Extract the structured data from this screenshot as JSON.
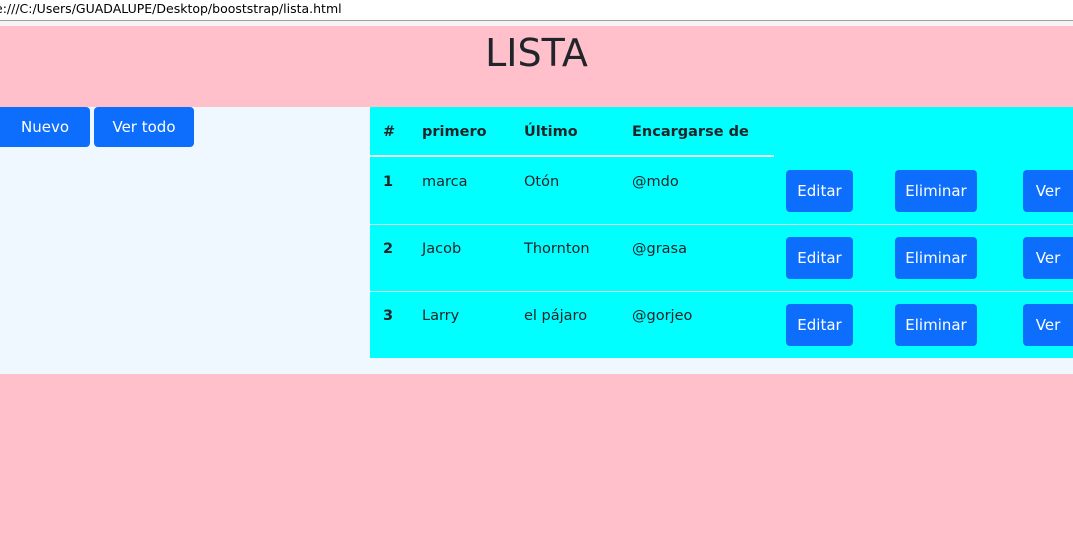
{
  "browser": {
    "url": "e:///C:/Users/GUADALUPE/Desktop/booststrap/lista.html"
  },
  "page": {
    "title": "LISTA"
  },
  "toolbar": {
    "new_label": "Nuevo",
    "view_all_label": "Ver todo"
  },
  "table": {
    "headers": [
      "#",
      "primero",
      "Último",
      "Encargarse de"
    ],
    "rows": [
      {
        "num": "1",
        "first": "marca",
        "last": "Otón",
        "handle": "@mdo",
        "edit": "Editar",
        "delete": "Eliminar",
        "view": "Ver"
      },
      {
        "num": "2",
        "first": "Jacob",
        "last": "Thornton",
        "handle": "@grasa",
        "edit": "Editar",
        "delete": "Eliminar",
        "view": "Ver"
      },
      {
        "num": "3",
        "first": "Larry",
        "last": "el pájaro",
        "handle": "@gorjeo",
        "edit": "Editar",
        "delete": "Eliminar",
        "view": "Ver"
      }
    ]
  },
  "colors": {
    "header_bg": "#ffc0cb",
    "content_bg": "#f0f8ff",
    "table_bg": "#00ffff",
    "button_bg": "#0d6efd"
  }
}
